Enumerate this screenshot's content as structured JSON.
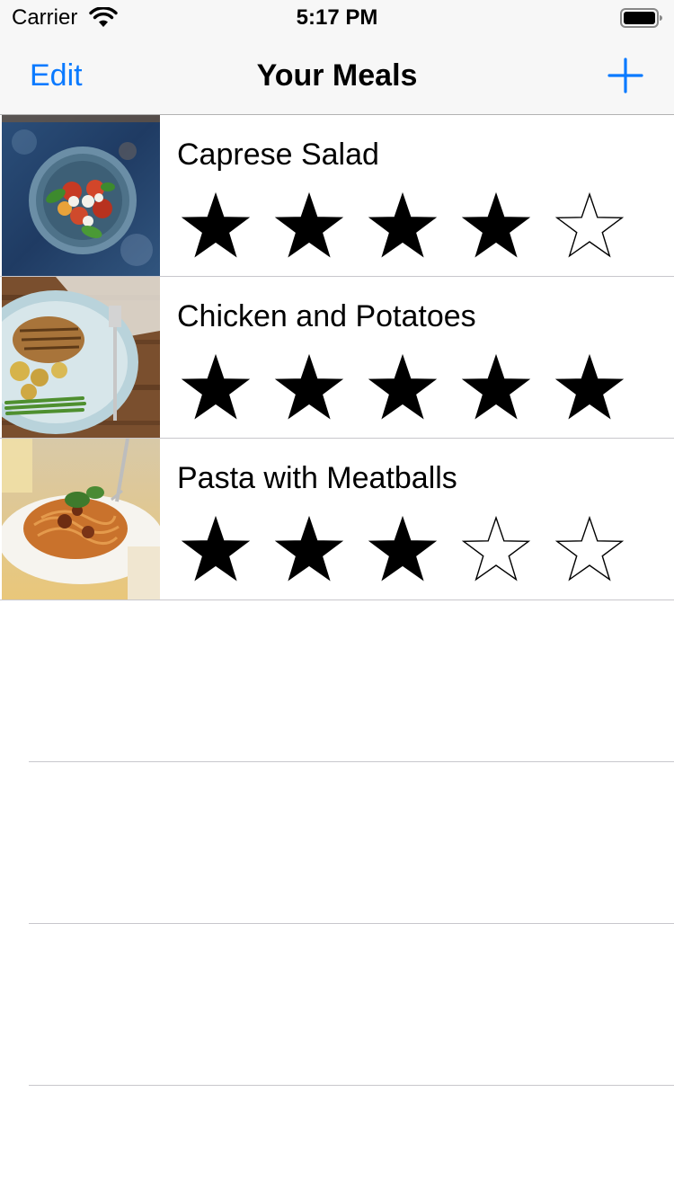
{
  "status_bar": {
    "carrier": "Carrier",
    "time": "5:17 PM",
    "icons": [
      "wifi-icon",
      "battery-icon"
    ]
  },
  "nav": {
    "edit_label": "Edit",
    "title": "Your Meals",
    "add_icon": "plus-icon",
    "accent_color": "#0a7aff"
  },
  "meals": [
    {
      "name": "Caprese Salad",
      "rating": 4,
      "max_rating": 5,
      "photo": "caprese-salad-photo"
    },
    {
      "name": "Chicken and Potatoes",
      "rating": 5,
      "max_rating": 5,
      "photo": "chicken-potatoes-photo"
    },
    {
      "name": "Pasta with Meatballs",
      "rating": 3,
      "max_rating": 5,
      "photo": "pasta-meatballs-photo"
    }
  ]
}
